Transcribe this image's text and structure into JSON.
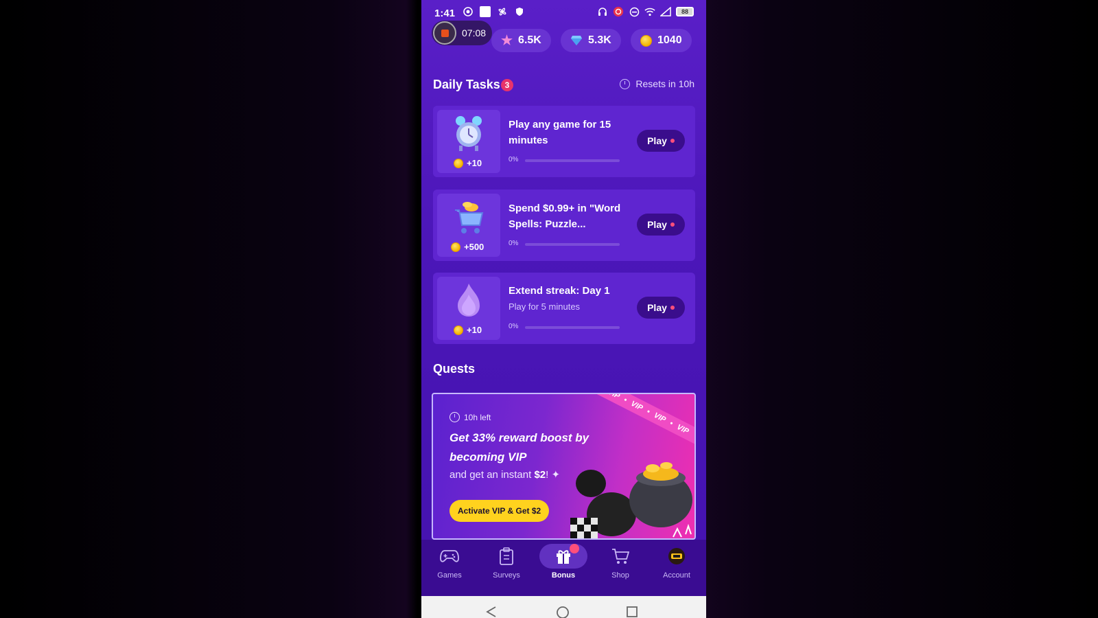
{
  "status_bar": {
    "time": "1:41",
    "battery": "88"
  },
  "recording": {
    "elapsed": "07:08"
  },
  "currencies": {
    "stars": "6.5K",
    "gems": "5.3K",
    "coins": "1040"
  },
  "daily_tasks": {
    "title": "Daily Tasks",
    "badge_count": "3",
    "resets_text": "Resets in 10h",
    "tasks": [
      {
        "title": "Play any game for 15 minutes",
        "subtitle": "",
        "reward": "+10",
        "progress_text": "0%",
        "progress": 0,
        "button": "Play",
        "icon": "alarm-clock-icon"
      },
      {
        "title": "Spend $0.99+ in \"Word Spells: Puzzle...",
        "subtitle": "",
        "reward": "+500",
        "progress_text": "0%",
        "progress": 0,
        "button": "Play",
        "icon": "shopping-cart-coins-icon"
      },
      {
        "title": "Extend streak: Day 1",
        "subtitle": "Play for 5 minutes",
        "reward": "+10",
        "progress_text": "0%",
        "progress": 0,
        "button": "Play",
        "icon": "flame-icon"
      }
    ]
  },
  "quests": {
    "title": "Quests",
    "banner": {
      "time_left": "10h left",
      "title": "Get 33% reward boost by becoming VIP",
      "subtitle_prefix": "and get an instant",
      "subtitle_amount": "$2",
      "subtitle_suffix": "!",
      "button": "Activate VIP & Get $2",
      "ribbon_text": "VIP",
      "accent": "#ffd21e"
    }
  },
  "bottom_nav": {
    "items": [
      {
        "label": "Games",
        "icon": "gamepad-icon",
        "active": false
      },
      {
        "label": "Surveys",
        "icon": "clipboard-icon",
        "active": false
      },
      {
        "label": "Bonus",
        "icon": "gift-icon",
        "active": true
      },
      {
        "label": "Shop",
        "icon": "cart-icon",
        "active": false
      },
      {
        "label": "Account",
        "icon": "avatar-icon",
        "active": false
      }
    ]
  },
  "colors": {
    "background": "#4b16b8",
    "card": "#5f25d0",
    "badge": "#e8346b",
    "coin": "#f4b400"
  }
}
